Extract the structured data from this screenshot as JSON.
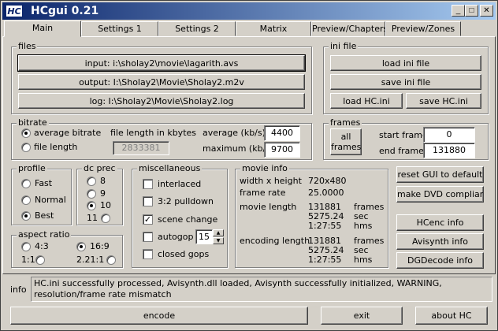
{
  "app": {
    "icon_text": "HC",
    "title": "HCgui 0.21"
  },
  "title_buttons": {
    "minimize": "_",
    "maximize": "□",
    "close": "✕"
  },
  "tabs": [
    "Main",
    "Settings 1",
    "Settings 2",
    "Matrix",
    "Preview/Chapters",
    "Preview/Zones"
  ],
  "files": {
    "legend": "files",
    "input": "input: i:\\sholay2\\movie\\lagarith.avs",
    "output": "output: I:\\Sholay2\\Movie\\Sholay2.m2v",
    "log": "log: I:\\Sholay2\\Movie\\Sholay2.log"
  },
  "ini": {
    "legend": "ini file",
    "load_ini": "load ini file",
    "save_ini": "save ini file",
    "load_hc": "load HC.ini",
    "save_hc": "save HC.ini"
  },
  "bitrate": {
    "legend": "bitrate",
    "avg_label": "average bitrate",
    "file_label": "file length",
    "length_caption": "file length in kbytes",
    "length_value": "2833381",
    "avg_kbs_label": "average (kb/s)",
    "avg_kbs_value": "4400",
    "max_kbs_label": "maximum (kb/s)",
    "max_kbs_value": "9700"
  },
  "frames": {
    "legend": "frames",
    "all_line1": "all",
    "all_line2": "frames",
    "start_label": "start frame",
    "start_value": "0",
    "end_label": "end frame",
    "end_value": "131880"
  },
  "profile": {
    "legend": "profile",
    "options": [
      "Fast",
      "Normal",
      "Best"
    ],
    "selected": "Best"
  },
  "dcprec": {
    "legend": "dc prec",
    "options": [
      "8",
      "9",
      "10",
      "11"
    ],
    "selected": "10"
  },
  "aspect": {
    "legend": "aspect ratio",
    "options": [
      "4:3",
      "16:9",
      "1:1",
      "2.21:1"
    ],
    "selected": "16:9"
  },
  "misc": {
    "legend": "miscellaneous",
    "interlaced": "interlaced",
    "pulldown": "3:2 pulldown",
    "scene_change": "scene change",
    "autogop": "autogop",
    "autogop_value": "15",
    "closed_gops": "closed gops"
  },
  "movie_info": {
    "legend": "movie info",
    "wh_label": "width x height",
    "wh_value": "720x480",
    "fr_label": "frame rate",
    "fr_value": "25.0000",
    "ml_label": "movie length",
    "ml_frames": "131881",
    "ml_sec": "5275.24",
    "ml_hms": "1:27:55",
    "el_label": "encoding length",
    "el_frames": "131881",
    "el_sec": "5275.24",
    "el_hms": "1:27:55",
    "unit_frames": "frames",
    "unit_sec": "sec",
    "unit_hms": "hms"
  },
  "side_buttons": {
    "reset": "reset GUI to default",
    "dvd": "make DVD compliant",
    "hcenc": "HCenc info",
    "avisynth": "Avisynth info",
    "dgdecode": "DGDecode info"
  },
  "info": {
    "label": "info",
    "text": "HC.ini successfully processed, Avisynth.dll loaded, Avisynth successfully initialized, WARNING, resolution/frame rate mismatch"
  },
  "bottom": {
    "encode": "encode",
    "exit": "exit",
    "about": "about HC"
  }
}
